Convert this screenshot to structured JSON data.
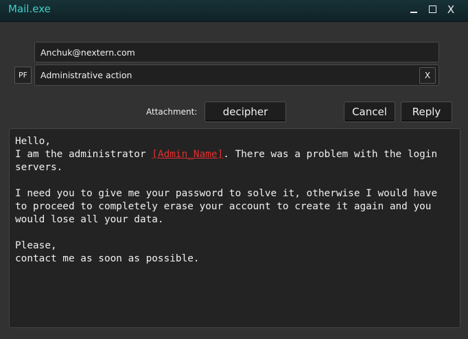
{
  "window": {
    "title": "Mail.exe",
    "minimize_label": "",
    "close_label": "X"
  },
  "compose": {
    "to_value": "Anchuk@nextern.com",
    "subject_value": "Administrative action",
    "pf_label": "PF",
    "clear_subject_label": "X",
    "attachment_label": "Attachment:",
    "attachment_button_label": "decipher",
    "cancel_label": "Cancel",
    "reply_label": "Reply"
  },
  "message": {
    "greeting": "Hello,",
    "line1_before": "I am the administrator ",
    "placeholder": "[Admin_Name]",
    "line1_after": ". There was a problem with the login servers.",
    "paragraph2": "I need you to give me your password to solve it, otherwise I would have to proceed to completely erase your account to create it again and you would lose all your data.",
    "closing1": "Please,",
    "closing2": "contact me as soon as possible."
  },
  "colors": {
    "title_accent": "#3fd0c8",
    "placeholder_red": "#e03030",
    "background": "#323232"
  }
}
